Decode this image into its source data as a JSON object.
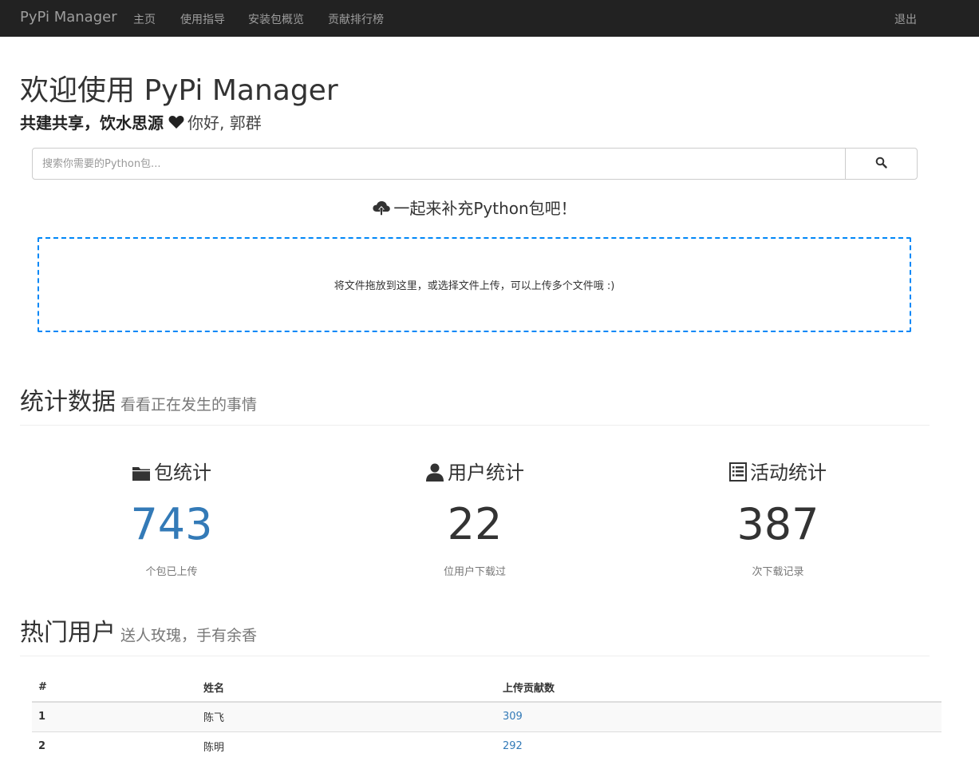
{
  "nav": {
    "brand": "PyPi Manager",
    "items": [
      {
        "label": "主页"
      },
      {
        "label": "使用指导"
      },
      {
        "label": "安装包概览"
      },
      {
        "label": "贡献排行榜"
      }
    ],
    "logout": "退出"
  },
  "hero": {
    "title": "欢迎使用 PyPi Manager",
    "motto": "共建共享，饮水思源",
    "greeting": "你好, 郭群"
  },
  "search": {
    "placeholder": "搜索你需要的Python包..."
  },
  "upload": {
    "title": "一起来补充Python包吧！",
    "dropzone_text": "将文件拖放到这里，或选择文件上传，可以上传多个文件哦 :)"
  },
  "stats_section": {
    "title": "统计数据",
    "subtitle": "看看正在发生的事情",
    "items": [
      {
        "icon": "folder-icon",
        "label": "包统计",
        "value": "743",
        "desc": "个包已上传"
      },
      {
        "icon": "user-icon",
        "label": "用户统计",
        "value": "22",
        "desc": "位用户下载过"
      },
      {
        "icon": "list-icon",
        "label": "活动统计",
        "value": "387",
        "desc": "次下载记录"
      }
    ]
  },
  "top_users": {
    "title": "热门用户",
    "subtitle": "送人玫瑰，手有余香",
    "columns": [
      "#",
      "姓名",
      "上传贡献数"
    ],
    "rows": [
      {
        "rank": "1",
        "name": "陈飞",
        "count": "309"
      },
      {
        "rank": "2",
        "name": "陈明",
        "count": "292"
      }
    ]
  },
  "colors": {
    "navbar": "#222222",
    "link": "#337ab7",
    "dropzone_border": "#0087f7"
  }
}
